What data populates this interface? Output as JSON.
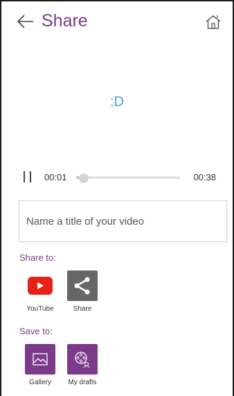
{
  "header": {
    "title": "Share"
  },
  "preview": {
    "text": ":D"
  },
  "player": {
    "current_time": "00:01",
    "total_time": "00:38",
    "progress": 0.026
  },
  "title_input": {
    "value": "",
    "placeholder": "Name a title of your video"
  },
  "share_to": {
    "label": "Share to:",
    "items": [
      {
        "label": "YouTube",
        "icon": "youtube-icon",
        "color": "#e62117"
      },
      {
        "label": "Share",
        "icon": "share-icon",
        "color": "#666666"
      }
    ]
  },
  "save_to": {
    "label": "Save to:",
    "items": [
      {
        "label": "Gallery",
        "icon": "gallery-icon",
        "color": "#7b3b8a"
      },
      {
        "label": "My drafts",
        "icon": "drafts-icon",
        "color": "#7b3b8a"
      }
    ]
  },
  "colors": {
    "accent": "#7b3b8a",
    "preview_text": "#4aa3d9"
  }
}
